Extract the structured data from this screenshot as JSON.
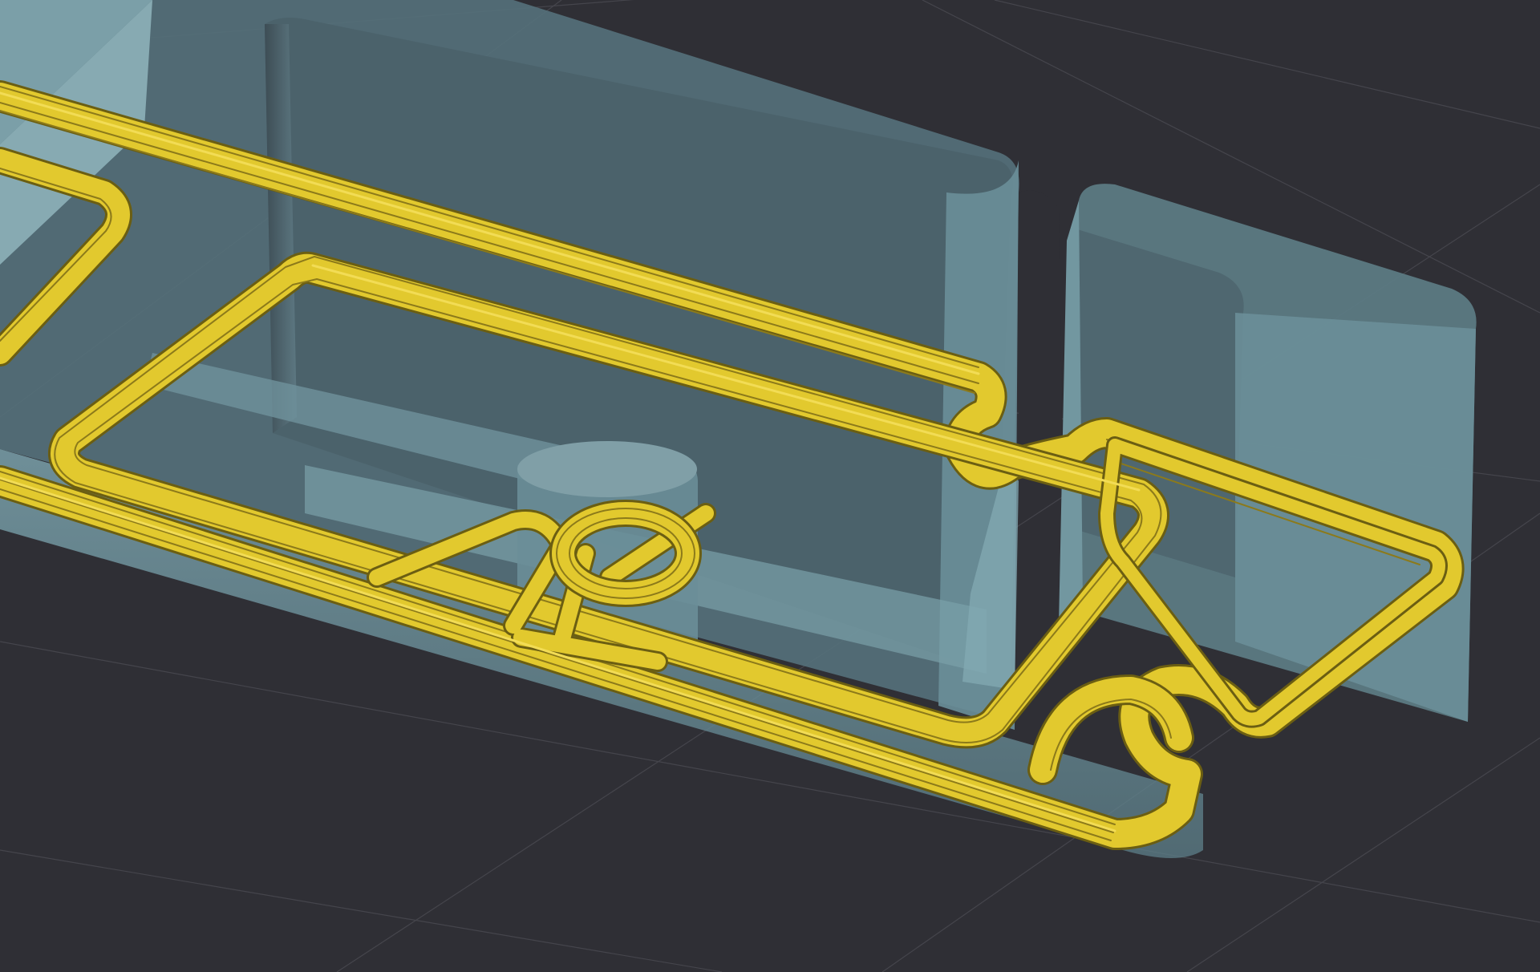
{
  "viewport": {
    "name": "3d-preview-viewport",
    "background_color": "#2f2f35",
    "grid_color": "#45454c"
  },
  "part_model": {
    "name": "translucent-part-model",
    "top_color": "#566b73",
    "side_color": "#6f929c",
    "inner_wall_color": "#7ea8b2",
    "recess_floor_color": "#4a5f68",
    "highlight_color": "#9fc4cc"
  },
  "toolpath": {
    "name": "sliced-perimeter-toolpath",
    "extrusion_color": "#e2c92e",
    "extrusion_dark_color": "#6b5e12",
    "extrusion_light_color": "#f2dc55",
    "perimeter_line_count": 6
  }
}
